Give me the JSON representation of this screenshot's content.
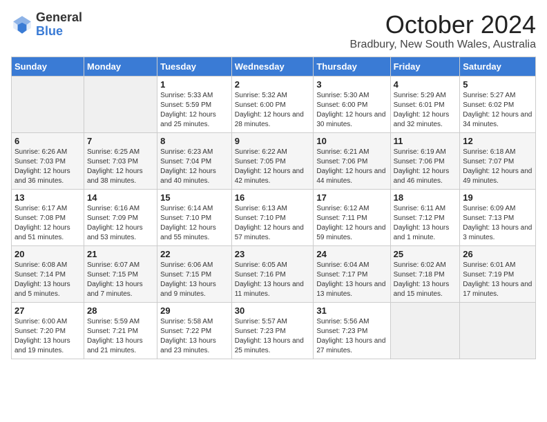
{
  "logo": {
    "general": "General",
    "blue": "Blue"
  },
  "title": "October 2024",
  "location": "Bradbury, New South Wales, Australia",
  "days_of_week": [
    "Sunday",
    "Monday",
    "Tuesday",
    "Wednesday",
    "Thursday",
    "Friday",
    "Saturday"
  ],
  "weeks": [
    [
      {
        "day": "",
        "sunrise": "",
        "sunset": "",
        "daylight": ""
      },
      {
        "day": "",
        "sunrise": "",
        "sunset": "",
        "daylight": ""
      },
      {
        "day": "1",
        "sunrise": "Sunrise: 5:33 AM",
        "sunset": "Sunset: 5:59 PM",
        "daylight": "Daylight: 12 hours and 25 minutes."
      },
      {
        "day": "2",
        "sunrise": "Sunrise: 5:32 AM",
        "sunset": "Sunset: 6:00 PM",
        "daylight": "Daylight: 12 hours and 28 minutes."
      },
      {
        "day": "3",
        "sunrise": "Sunrise: 5:30 AM",
        "sunset": "Sunset: 6:00 PM",
        "daylight": "Daylight: 12 hours and 30 minutes."
      },
      {
        "day": "4",
        "sunrise": "Sunrise: 5:29 AM",
        "sunset": "Sunset: 6:01 PM",
        "daylight": "Daylight: 12 hours and 32 minutes."
      },
      {
        "day": "5",
        "sunrise": "Sunrise: 5:27 AM",
        "sunset": "Sunset: 6:02 PM",
        "daylight": "Daylight: 12 hours and 34 minutes."
      }
    ],
    [
      {
        "day": "6",
        "sunrise": "Sunrise: 6:26 AM",
        "sunset": "Sunset: 7:03 PM",
        "daylight": "Daylight: 12 hours and 36 minutes."
      },
      {
        "day": "7",
        "sunrise": "Sunrise: 6:25 AM",
        "sunset": "Sunset: 7:03 PM",
        "daylight": "Daylight: 12 hours and 38 minutes."
      },
      {
        "day": "8",
        "sunrise": "Sunrise: 6:23 AM",
        "sunset": "Sunset: 7:04 PM",
        "daylight": "Daylight: 12 hours and 40 minutes."
      },
      {
        "day": "9",
        "sunrise": "Sunrise: 6:22 AM",
        "sunset": "Sunset: 7:05 PM",
        "daylight": "Daylight: 12 hours and 42 minutes."
      },
      {
        "day": "10",
        "sunrise": "Sunrise: 6:21 AM",
        "sunset": "Sunset: 7:06 PM",
        "daylight": "Daylight: 12 hours and 44 minutes."
      },
      {
        "day": "11",
        "sunrise": "Sunrise: 6:19 AM",
        "sunset": "Sunset: 7:06 PM",
        "daylight": "Daylight: 12 hours and 46 minutes."
      },
      {
        "day": "12",
        "sunrise": "Sunrise: 6:18 AM",
        "sunset": "Sunset: 7:07 PM",
        "daylight": "Daylight: 12 hours and 49 minutes."
      }
    ],
    [
      {
        "day": "13",
        "sunrise": "Sunrise: 6:17 AM",
        "sunset": "Sunset: 7:08 PM",
        "daylight": "Daylight: 12 hours and 51 minutes."
      },
      {
        "day": "14",
        "sunrise": "Sunrise: 6:16 AM",
        "sunset": "Sunset: 7:09 PM",
        "daylight": "Daylight: 12 hours and 53 minutes."
      },
      {
        "day": "15",
        "sunrise": "Sunrise: 6:14 AM",
        "sunset": "Sunset: 7:10 PM",
        "daylight": "Daylight: 12 hours and 55 minutes."
      },
      {
        "day": "16",
        "sunrise": "Sunrise: 6:13 AM",
        "sunset": "Sunset: 7:10 PM",
        "daylight": "Daylight: 12 hours and 57 minutes."
      },
      {
        "day": "17",
        "sunrise": "Sunrise: 6:12 AM",
        "sunset": "Sunset: 7:11 PM",
        "daylight": "Daylight: 12 hours and 59 minutes."
      },
      {
        "day": "18",
        "sunrise": "Sunrise: 6:11 AM",
        "sunset": "Sunset: 7:12 PM",
        "daylight": "Daylight: 13 hours and 1 minute."
      },
      {
        "day": "19",
        "sunrise": "Sunrise: 6:09 AM",
        "sunset": "Sunset: 7:13 PM",
        "daylight": "Daylight: 13 hours and 3 minutes."
      }
    ],
    [
      {
        "day": "20",
        "sunrise": "Sunrise: 6:08 AM",
        "sunset": "Sunset: 7:14 PM",
        "daylight": "Daylight: 13 hours and 5 minutes."
      },
      {
        "day": "21",
        "sunrise": "Sunrise: 6:07 AM",
        "sunset": "Sunset: 7:15 PM",
        "daylight": "Daylight: 13 hours and 7 minutes."
      },
      {
        "day": "22",
        "sunrise": "Sunrise: 6:06 AM",
        "sunset": "Sunset: 7:15 PM",
        "daylight": "Daylight: 13 hours and 9 minutes."
      },
      {
        "day": "23",
        "sunrise": "Sunrise: 6:05 AM",
        "sunset": "Sunset: 7:16 PM",
        "daylight": "Daylight: 13 hours and 11 minutes."
      },
      {
        "day": "24",
        "sunrise": "Sunrise: 6:04 AM",
        "sunset": "Sunset: 7:17 PM",
        "daylight": "Daylight: 13 hours and 13 minutes."
      },
      {
        "day": "25",
        "sunrise": "Sunrise: 6:02 AM",
        "sunset": "Sunset: 7:18 PM",
        "daylight": "Daylight: 13 hours and 15 minutes."
      },
      {
        "day": "26",
        "sunrise": "Sunrise: 6:01 AM",
        "sunset": "Sunset: 7:19 PM",
        "daylight": "Daylight: 13 hours and 17 minutes."
      }
    ],
    [
      {
        "day": "27",
        "sunrise": "Sunrise: 6:00 AM",
        "sunset": "Sunset: 7:20 PM",
        "daylight": "Daylight: 13 hours and 19 minutes."
      },
      {
        "day": "28",
        "sunrise": "Sunrise: 5:59 AM",
        "sunset": "Sunset: 7:21 PM",
        "daylight": "Daylight: 13 hours and 21 minutes."
      },
      {
        "day": "29",
        "sunrise": "Sunrise: 5:58 AM",
        "sunset": "Sunset: 7:22 PM",
        "daylight": "Daylight: 13 hours and 23 minutes."
      },
      {
        "day": "30",
        "sunrise": "Sunrise: 5:57 AM",
        "sunset": "Sunset: 7:23 PM",
        "daylight": "Daylight: 13 hours and 25 minutes."
      },
      {
        "day": "31",
        "sunrise": "Sunrise: 5:56 AM",
        "sunset": "Sunset: 7:23 PM",
        "daylight": "Daylight: 13 hours and 27 minutes."
      },
      {
        "day": "",
        "sunrise": "",
        "sunset": "",
        "daylight": ""
      },
      {
        "day": "",
        "sunrise": "",
        "sunset": "",
        "daylight": ""
      }
    ]
  ]
}
